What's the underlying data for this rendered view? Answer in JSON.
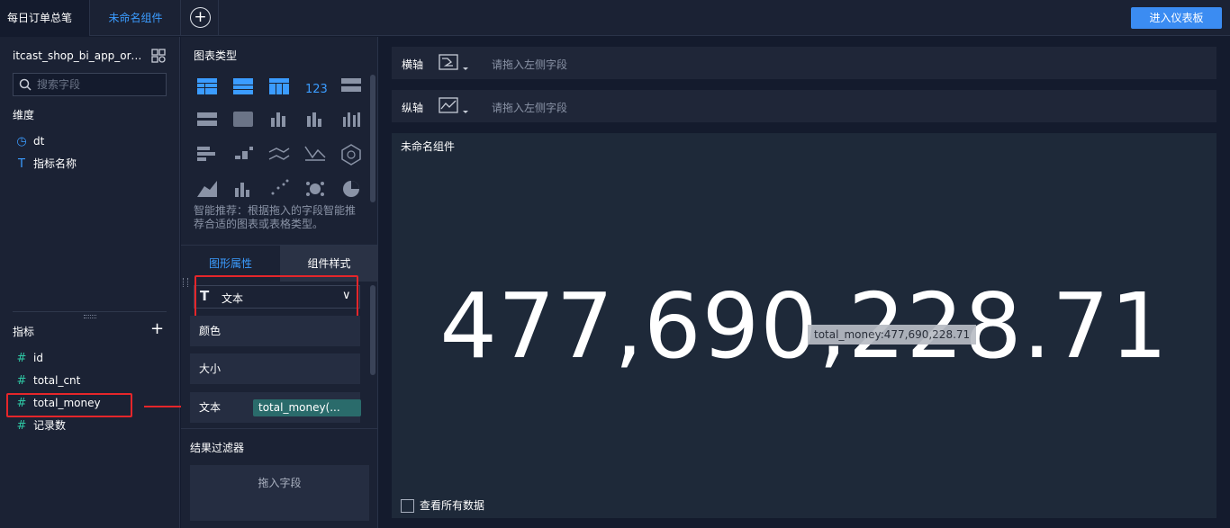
{
  "top_tabs": [
    "每日订单总笔数",
    "未命名组件"
  ],
  "enter_dashboard_label": "进入仪表板",
  "left": {
    "dataset": "itcast_shop_bi_app_orde...",
    "search_placeholder": "搜索字段",
    "dimension_title": "维度",
    "dimensions": [
      {
        "icon": "clock-icon",
        "label": "dt"
      },
      {
        "icon": "text-type-icon",
        "label": "指标名称"
      }
    ],
    "metric_title": "指标",
    "metrics": [
      {
        "icon": "hash-icon",
        "label": "id"
      },
      {
        "icon": "hash-icon",
        "label": "total_cnt"
      },
      {
        "icon": "hash-icon",
        "label": "total_money"
      },
      {
        "icon": "hash-icon",
        "label": "记录数"
      }
    ]
  },
  "mid": {
    "chart_types_title": "图表类型",
    "recommend_text": "智能推荐：根据拖入的字段智能推荐合适的图表或表格类型。",
    "tabs": [
      "图形属性",
      "组件样式"
    ],
    "dropdown_label": "文本",
    "props": {
      "color": "颜色",
      "size": "大小",
      "text": "文本"
    },
    "text_field_pill": "total_money(...",
    "filter_title": "结果过滤器",
    "filter_placeholder": "拖入字段"
  },
  "axes": {
    "x": {
      "name": "横轴",
      "placeholder": "请拖入左侧字段"
    },
    "y": {
      "name": "纵轴",
      "placeholder": "请拖入左侧字段"
    }
  },
  "canvas": {
    "title": "未命名组件",
    "value": "477,690,228.71",
    "tooltip": "total_money:477,690,228.71",
    "view_all": "查看所有数据"
  },
  "colors": {
    "accent": "#3b9cff",
    "button": "#3b8cf2",
    "highlight": "#e5262a",
    "pill": "#2a6b6b"
  }
}
